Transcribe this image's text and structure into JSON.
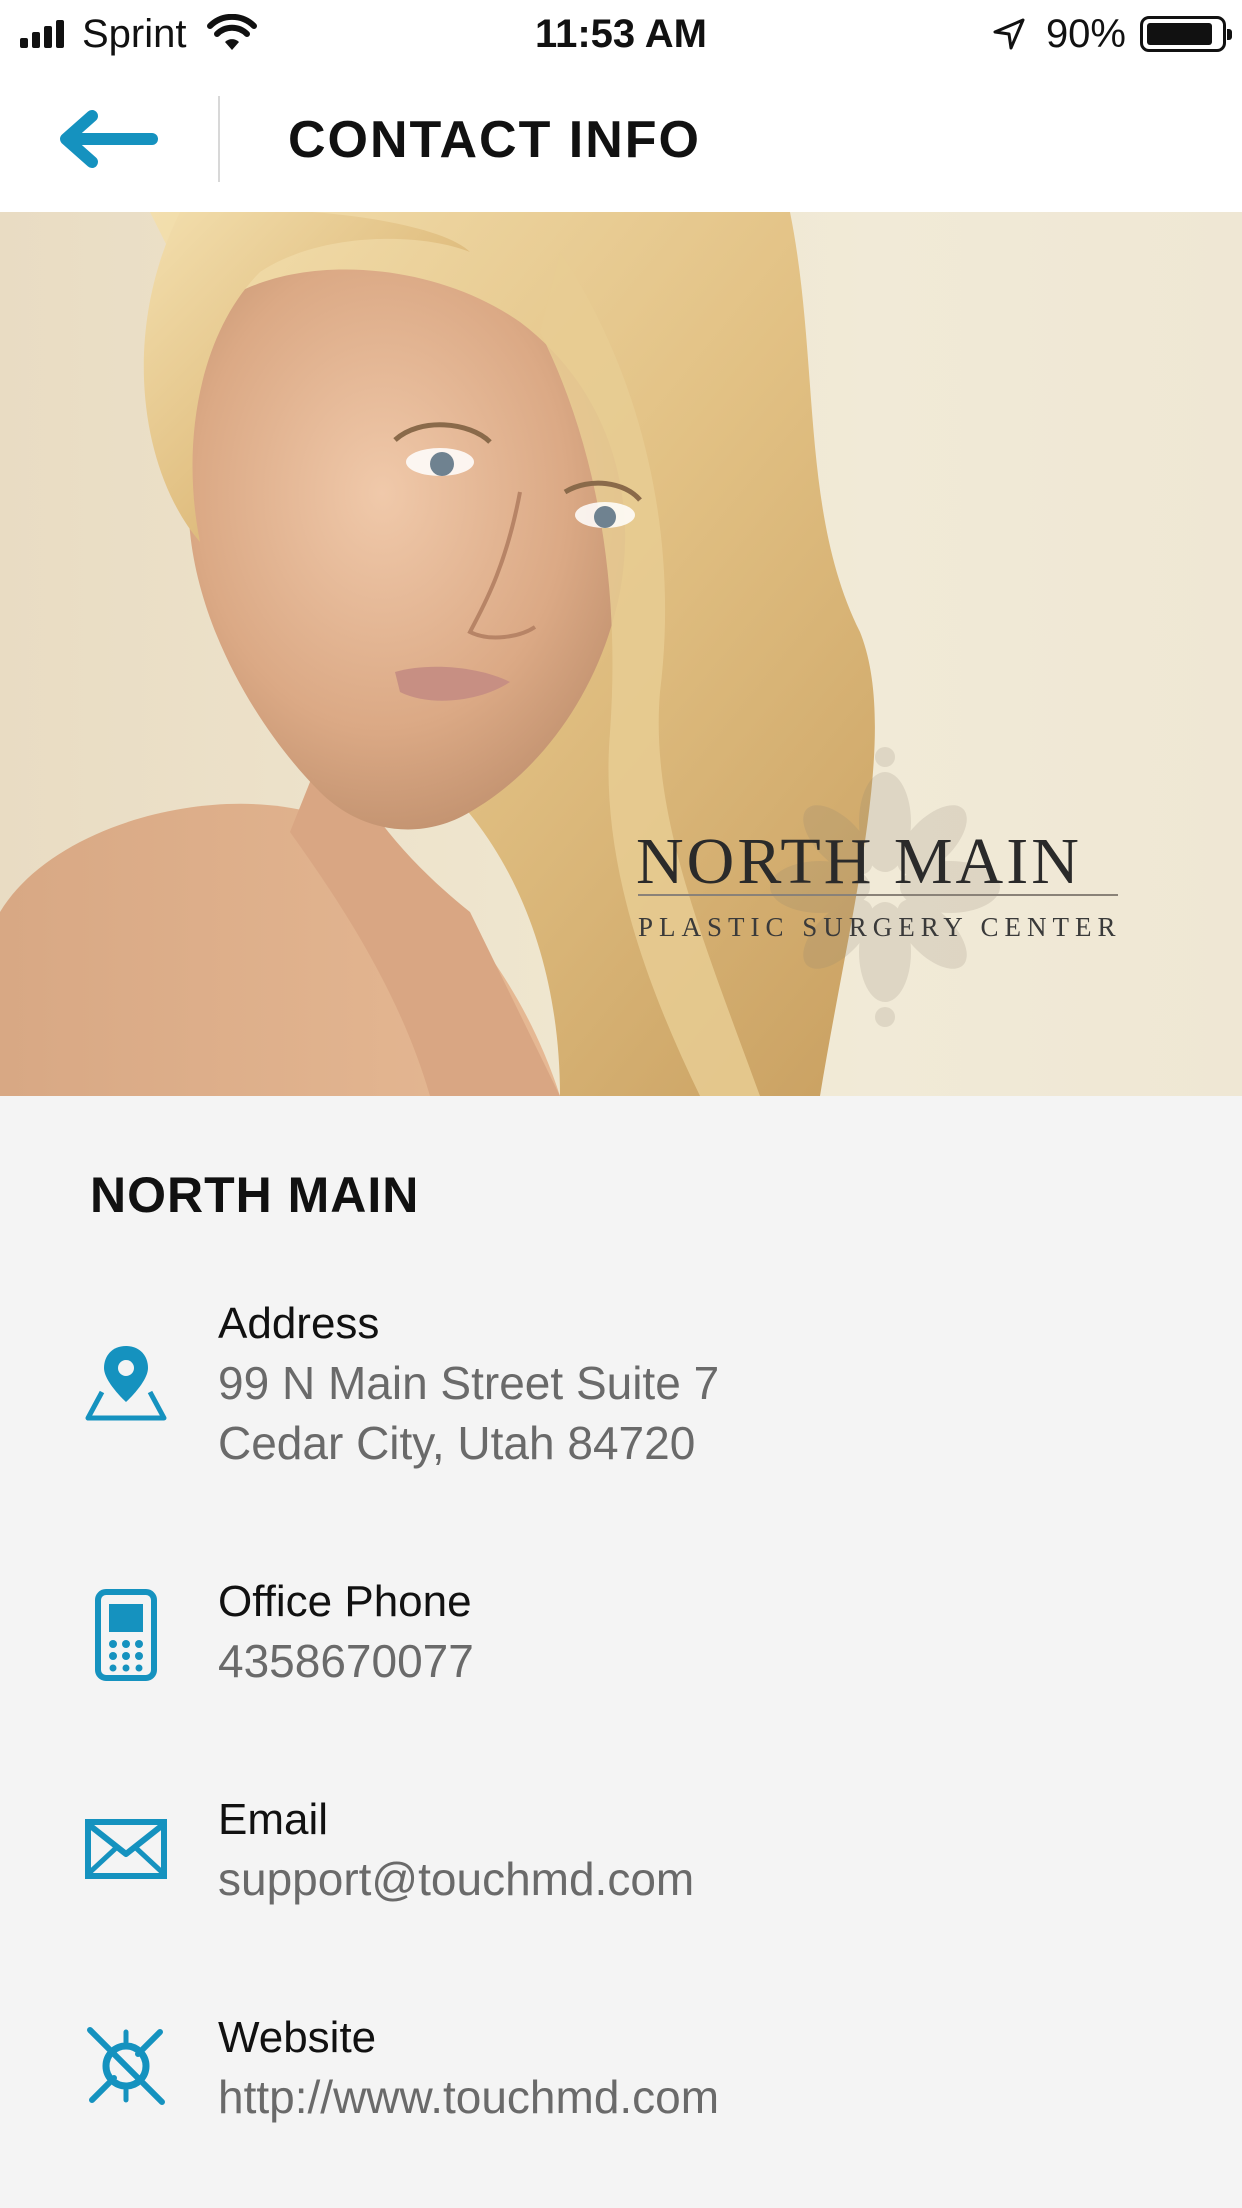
{
  "status_bar": {
    "carrier": "Sprint",
    "time": "11:53 AM",
    "battery_percent": "90%",
    "battery_level": 0.9,
    "icons": [
      "signal-icon",
      "wifi-icon",
      "location-arrow-icon",
      "battery-icon"
    ]
  },
  "header": {
    "title": "CONTACT INFO",
    "back_icon": "arrow-left-icon"
  },
  "hero": {
    "brand_name": "NORTH MAIN",
    "brand_tagline": "PLASTIC SURGERY CENTER"
  },
  "practice": {
    "name": "NORTH MAIN"
  },
  "contacts": [
    {
      "icon": "map-pin-icon",
      "label": "Address",
      "value_line1": "99 N Main Street Suite 7",
      "value_line2": "Cedar City, Utah  84720"
    },
    {
      "icon": "mobile-phone-icon",
      "label": "Office Phone",
      "value_line1": "4358670077"
    },
    {
      "icon": "envelope-icon",
      "label": "Email",
      "value_line1": "support@touchmd.com"
    },
    {
      "icon": "compass-icon",
      "label": "Website",
      "value_line1": "http://www.touchmd.com"
    }
  ],
  "colors": {
    "accent": "#1592bf",
    "background": "#f4f4f4",
    "header_bg": "#ffffff",
    "value_text": "#6a6a6a"
  }
}
